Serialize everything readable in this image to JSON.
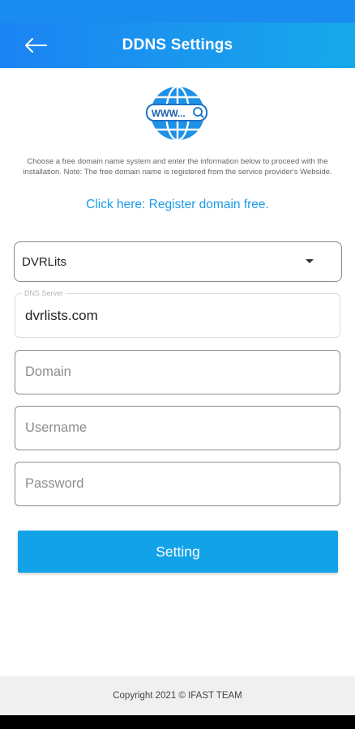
{
  "header": {
    "title": "DDNS Settings",
    "back_icon": "arrow-left-icon"
  },
  "hero": {
    "icon": "globe-www-icon",
    "icon_text": "WWW...",
    "description": "Choose a free domain name system and enter the information below to proceed with the installation. Note: The free domain name is registered from the service provider's Webside.",
    "register_link": "Click here: Register domain free."
  },
  "form": {
    "provider_select": {
      "value": "DVRLits",
      "icon": "caret-down-icon"
    },
    "dns_server": {
      "label": "DNS Server",
      "value": "dvrlists.com"
    },
    "domain": {
      "placeholder": "Domain",
      "value": ""
    },
    "username": {
      "placeholder": "Username",
      "value": ""
    },
    "password": {
      "placeholder": "Password",
      "value": ""
    },
    "submit_label": "Setting"
  },
  "footer": {
    "copyright": "Copyright 2021 © IFAST TEAM"
  },
  "colors": {
    "primary": "#1a8cf0",
    "button": "#12a2e8",
    "link": "#1a9ae8",
    "footer_bg": "#f0f0f0"
  }
}
